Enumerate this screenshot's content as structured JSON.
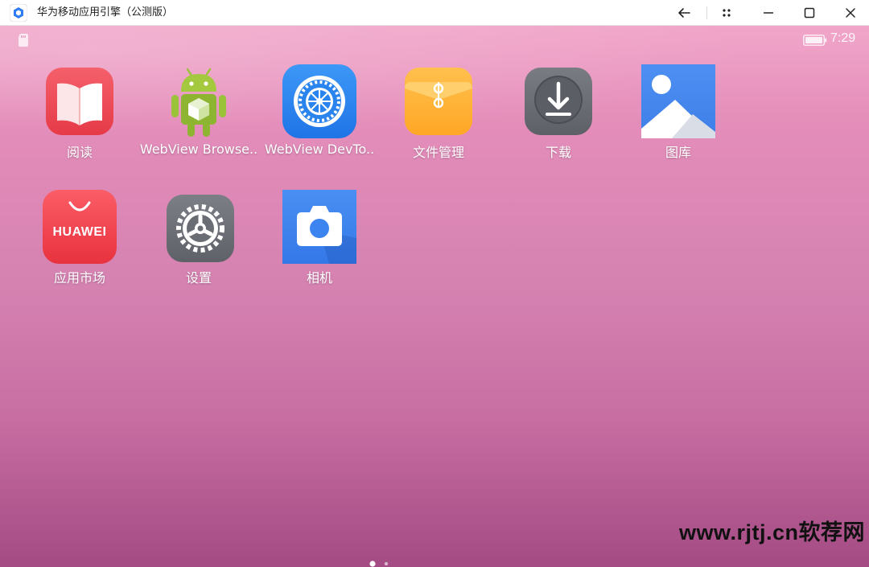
{
  "window": {
    "title": "华为移动应用引擎（公测版）",
    "buttons": [
      "back",
      "more",
      "minimize",
      "maximize",
      "close"
    ]
  },
  "status_bar": {
    "time": "7:29",
    "icons": [
      "sd-card-icon",
      "battery-icon"
    ]
  },
  "apps": [
    {
      "label": "阅读",
      "icon": "book-reader-icon",
      "color": "#ee4b57"
    },
    {
      "label": "WebView Browse..",
      "icon": "android-robot-icon",
      "color": "#9bc339"
    },
    {
      "label": "WebView DevTo..",
      "icon": "gear-globe-icon",
      "color": "#2f86f0"
    },
    {
      "label": "文件管理",
      "icon": "file-manager-folder-icon",
      "color": "#ffb433"
    },
    {
      "label": "下载",
      "icon": "download-arrow-icon",
      "color": "#6d6f76"
    },
    {
      "label": "图库",
      "icon": "gallery-mountain-icon",
      "color": "#3f86ef"
    },
    {
      "label": "应用市场",
      "icon": "huawei-appgallery-icon",
      "color": "#ed3f4f",
      "icon_text": "HUAWEI"
    },
    {
      "label": "设置",
      "icon": "settings-gear-icon",
      "color": "#6f7279"
    },
    {
      "label": "相机",
      "icon": "camera-icon",
      "color": "#3b83ee"
    }
  ],
  "pager": {
    "total": 2,
    "current": 1
  },
  "watermark": "www.rjtj.cn软荐网"
}
